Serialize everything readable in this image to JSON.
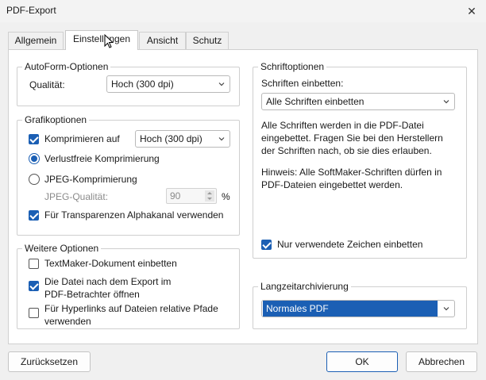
{
  "window": {
    "title": "PDF-Export"
  },
  "tabs": [
    "Allgemein",
    "Einstellungen",
    "Ansicht",
    "Schutz"
  ],
  "autoform": {
    "legend": "AutoForm-Optionen",
    "quality_label": "Qualität:",
    "quality_value": "Hoch (300 dpi)"
  },
  "graphics": {
    "legend": "Grafikoptionen",
    "compress_label": "Komprimieren auf",
    "compress_checked": true,
    "compress_value": "Hoch (300 dpi)",
    "lossless_label": "Verlustfreie Komprimierung",
    "lossless_selected": true,
    "jpeg_label": "JPEG-Komprimierung",
    "jpeg_selected": false,
    "jpeg_quality_label": "JPEG-Qualität:",
    "jpeg_quality_value": "90",
    "jpeg_quality_unit": "%",
    "alpha_label": "Für Transparenzen Alphakanal verwenden",
    "alpha_checked": true
  },
  "further": {
    "legend": "Weitere Optionen",
    "embed_doc_label": "TextMaker-Dokument einbetten",
    "embed_doc_checked": false,
    "open_viewer_line1": "Die Datei nach dem Export im",
    "open_viewer_line2": "PDF-Betrachter öffnen",
    "open_viewer_checked": true,
    "relative_paths_line1": "Für Hyperlinks auf Dateien relative Pfade",
    "relative_paths_line2": "verwenden",
    "relative_paths_checked": false
  },
  "fonts": {
    "legend": "Schriftoptionen",
    "embed_label": "Schriften einbetten:",
    "embed_value": "Alle Schriften einbetten",
    "desc_lines": [
      "Alle Schriften werden in die PDF-Datei",
      "eingebettet. Fragen Sie bei den Herstellern",
      "der Schriften nach, ob sie dies erlauben."
    ],
    "hint_lines": [
      "Hinweis: Alle SoftMaker-Schriften dürfen in",
      "PDF-Dateien eingebettet werden."
    ],
    "used_chars_label": "Nur verwendete Zeichen einbetten",
    "used_chars_checked": true
  },
  "archiving": {
    "legend": "Langzeitarchivierung",
    "value": "Normales PDF"
  },
  "buttons": {
    "reset": "Zurücksetzen",
    "ok": "OK",
    "cancel": "Abbrechen"
  },
  "colors": {
    "accent": "#1b5fb4",
    "selection": "#1b5fb4"
  }
}
